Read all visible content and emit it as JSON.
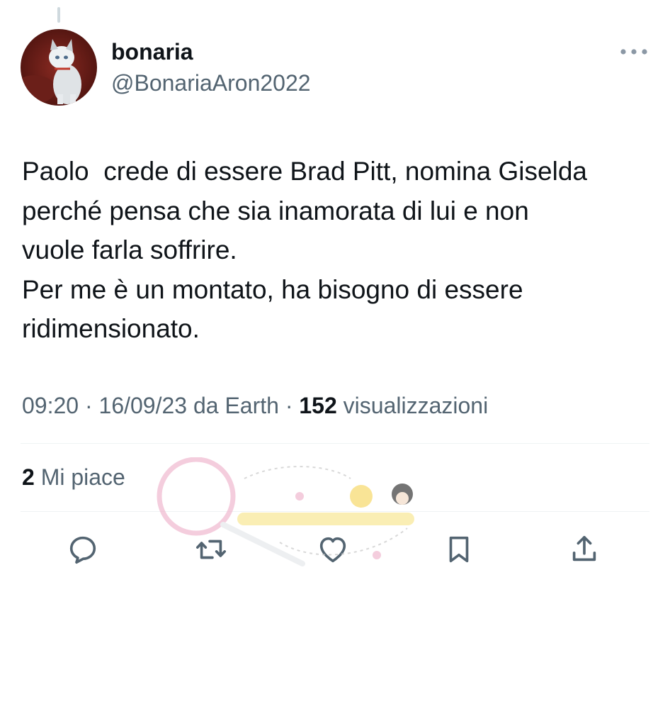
{
  "tweet": {
    "author": {
      "display_name": "bonaria",
      "handle": "@BonariaAron2022",
      "avatar_icon": "cat-avatar"
    },
    "more_icon": "more-dots-icon",
    "text": "Paolo  crede di essere Brad Pitt, nomina Giselda\nperché pensa che sia inamorata di lui e non\nvuole farla soffrire.\nPer me è un montato, ha bisogno di essere\nridimensionato.",
    "time": "09:20",
    "separator": " · ",
    "date": "16/09/23",
    "source": "da Earth",
    "views_count": "152",
    "views_label": "visualizzazioni",
    "likes_count": "2",
    "likes_label": "Mi piace"
  },
  "actions": [
    {
      "icon": "reply-icon"
    },
    {
      "icon": "retweet-icon"
    },
    {
      "icon": "like-icon"
    },
    {
      "icon": "bookmark-icon"
    },
    {
      "icon": "share-icon"
    }
  ],
  "colors": {
    "primary_text": "#0f1419",
    "secondary_text": "#536471",
    "divider": "#eff3f4",
    "watermark_pink": "#e9a3c1"
  }
}
